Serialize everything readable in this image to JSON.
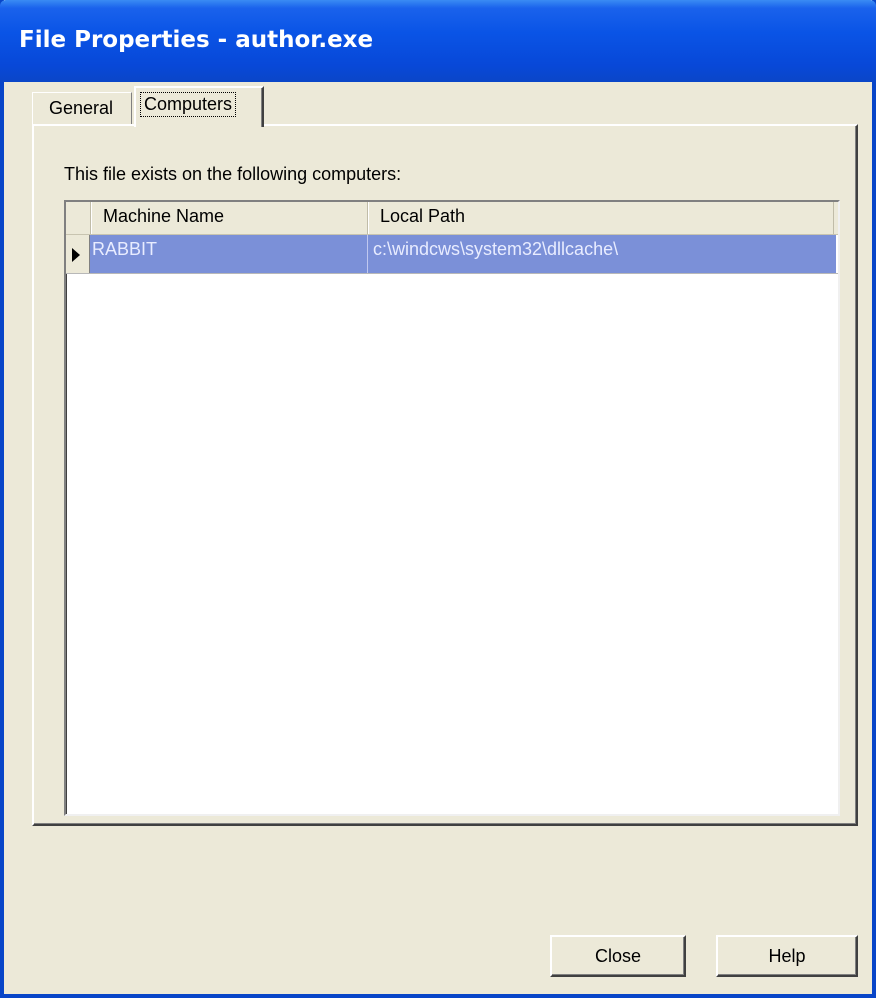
{
  "window": {
    "title": "File Properties - author.exe"
  },
  "tabs": [
    {
      "label": "General",
      "selected": false
    },
    {
      "label": "Computers",
      "selected": true
    }
  ],
  "panel": {
    "caption": "This file exists on the following computers:"
  },
  "grid": {
    "columns": [
      "Machine Name",
      "Local Path"
    ],
    "rows": [
      {
        "machine_name": "RABBIT",
        "local_path": "c:\\windcws\\system32\\dllcache\\",
        "selected": true
      }
    ]
  },
  "buttons": {
    "close_label": "Close",
    "help_label": "Help"
  },
  "colors": {
    "title_bar": "#0a54e6",
    "window_face": "#ece9d8",
    "selection": "#7b90d8"
  }
}
